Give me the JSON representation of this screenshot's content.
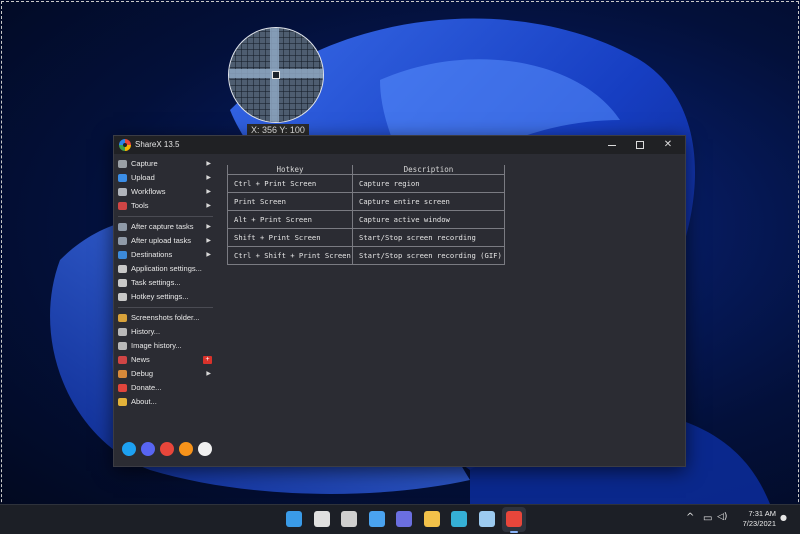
{
  "capture_overlay": {
    "coords_label": "X: 356 Y: 100"
  },
  "window": {
    "title": "ShareX 13.5",
    "minimize_icon": "minimize-icon",
    "maximize_icon": "maximize-icon",
    "close_icon": "close-icon"
  },
  "menu": {
    "group1": [
      {
        "label": "Capture",
        "icon": "capture-icon",
        "color": "#9aa0a6",
        "submenu": true
      },
      {
        "label": "Upload",
        "icon": "upload-icon",
        "color": "#3b8ee8",
        "submenu": true
      },
      {
        "label": "Workflows",
        "icon": "workflows-icon",
        "color": "#b0b4bb",
        "submenu": true
      },
      {
        "label": "Tools",
        "icon": "tools-icon",
        "color": "#d04545",
        "submenu": true
      }
    ],
    "group2": [
      {
        "label": "After capture tasks",
        "icon": "after-capture-icon",
        "color": "#8f9aa8",
        "submenu": true
      },
      {
        "label": "After upload tasks",
        "icon": "after-upload-icon",
        "color": "#8f9aa8",
        "submenu": true
      },
      {
        "label": "Destinations",
        "icon": "destinations-icon",
        "color": "#3c8ad9",
        "submenu": true
      },
      {
        "label": "Application settings...",
        "icon": "wrench-icon",
        "color": "#c9c9c9",
        "submenu": false
      },
      {
        "label": "Task settings...",
        "icon": "gear-icon",
        "color": "#c9c9c9",
        "submenu": false
      },
      {
        "label": "Hotkey settings...",
        "icon": "keyboard-icon",
        "color": "#c9c9c9",
        "submenu": false
      }
    ],
    "group3": [
      {
        "label": "Screenshots folder...",
        "icon": "folder-icon",
        "color": "#d8a23a",
        "submenu": false
      },
      {
        "label": "History...",
        "icon": "history-icon",
        "color": "#b8b8b8",
        "submenu": false
      },
      {
        "label": "Image history...",
        "icon": "image-history-icon",
        "color": "#b8b8b8",
        "submenu": false
      },
      {
        "label": "News",
        "icon": "megaphone-icon",
        "color": "#d04545",
        "submenu": false,
        "badge": "+"
      },
      {
        "label": "Debug",
        "icon": "bug-icon",
        "color": "#d88a3a",
        "submenu": true
      },
      {
        "label": "Donate...",
        "icon": "heart-icon",
        "color": "#e0453c",
        "submenu": false
      },
      {
        "label": "About...",
        "icon": "crown-icon",
        "color": "#e2b23a",
        "submenu": false
      }
    ]
  },
  "hotkeys": {
    "columns": [
      "Hotkey",
      "Description"
    ],
    "rows": [
      {
        "hotkey": "Ctrl + Print Screen",
        "description": "Capture region"
      },
      {
        "hotkey": "Print Screen",
        "description": "Capture entire screen"
      },
      {
        "hotkey": "Alt + Print Screen",
        "description": "Capture active window"
      },
      {
        "hotkey": "Shift + Print Screen",
        "description": "Start/Stop screen recording"
      },
      {
        "hotkey": "Ctrl + Shift + Print Screen",
        "description": "Start/Stop screen recording (GIF)"
      }
    ]
  },
  "social": [
    {
      "name": "twitter-icon",
      "color": "#1da1f2"
    },
    {
      "name": "discord-icon",
      "color": "#5865f2"
    },
    {
      "name": "patreon-icon",
      "color": "#e8463b"
    },
    {
      "name": "bitcoin-icon",
      "color": "#f7931a"
    },
    {
      "name": "github-icon",
      "color": "#f0f0f0"
    }
  ],
  "taskbar": {
    "apps": [
      {
        "name": "start-icon",
        "color": "#3a9be8"
      },
      {
        "name": "search-icon",
        "color": "#e0e0e0"
      },
      {
        "name": "task-view-icon",
        "color": "#cfcfcf"
      },
      {
        "name": "widgets-icon",
        "color": "#4aa3f0"
      },
      {
        "name": "teams-chat-icon",
        "color": "#6b6fe0"
      },
      {
        "name": "file-explorer-icon",
        "color": "#f2c14a"
      },
      {
        "name": "edge-icon",
        "color": "#35b0d6"
      },
      {
        "name": "store-icon",
        "color": "#9ccaf0"
      },
      {
        "name": "sharex-icon",
        "color": "#e8463b"
      }
    ],
    "clock_time": "7:31 AM",
    "clock_date": "7/23/2021"
  }
}
